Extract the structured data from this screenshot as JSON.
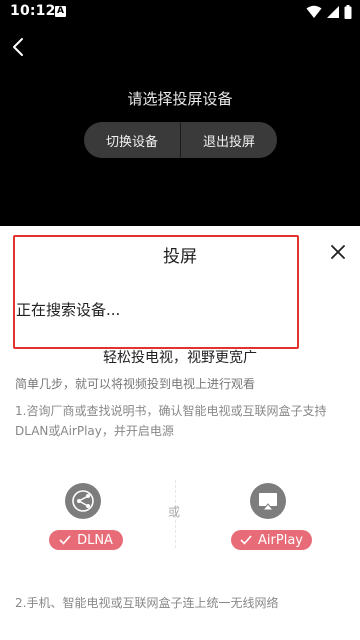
{
  "status_bar": {
    "time": "10:12",
    "notification_letter": "A"
  },
  "player": {
    "prompt": "请选择投屏设备",
    "buttons": {
      "switch_device": "切换设备",
      "exit_cast": "退出投屏"
    }
  },
  "sheet": {
    "title": "投屏",
    "searching": "正在搜索设备...",
    "slogan": "轻松投电视，视野更宽广",
    "description": "简单几步，就可以将视频投到电视上进行观看",
    "step1": "1.咨询厂商或查找说明书，确认智能电视或互联网盒子支持DLAN或AirPlay，并开启电源",
    "protocols": {
      "dlna": "DLNA",
      "or": "或",
      "airplay": "AirPlay"
    },
    "step2": "2.手机、智能电视或互联网盒子连上统一无线网络"
  },
  "colors": {
    "accent": "#e86c78",
    "highlight_border": "#e23333",
    "player_bg": "#000000",
    "button_bg": "#3a3a3a"
  },
  "icons": [
    "wifi-icon",
    "signal-icon",
    "battery-icon",
    "back-arrow-icon",
    "close-icon",
    "dlna-share-icon",
    "airplay-icon",
    "check-icon"
  ]
}
